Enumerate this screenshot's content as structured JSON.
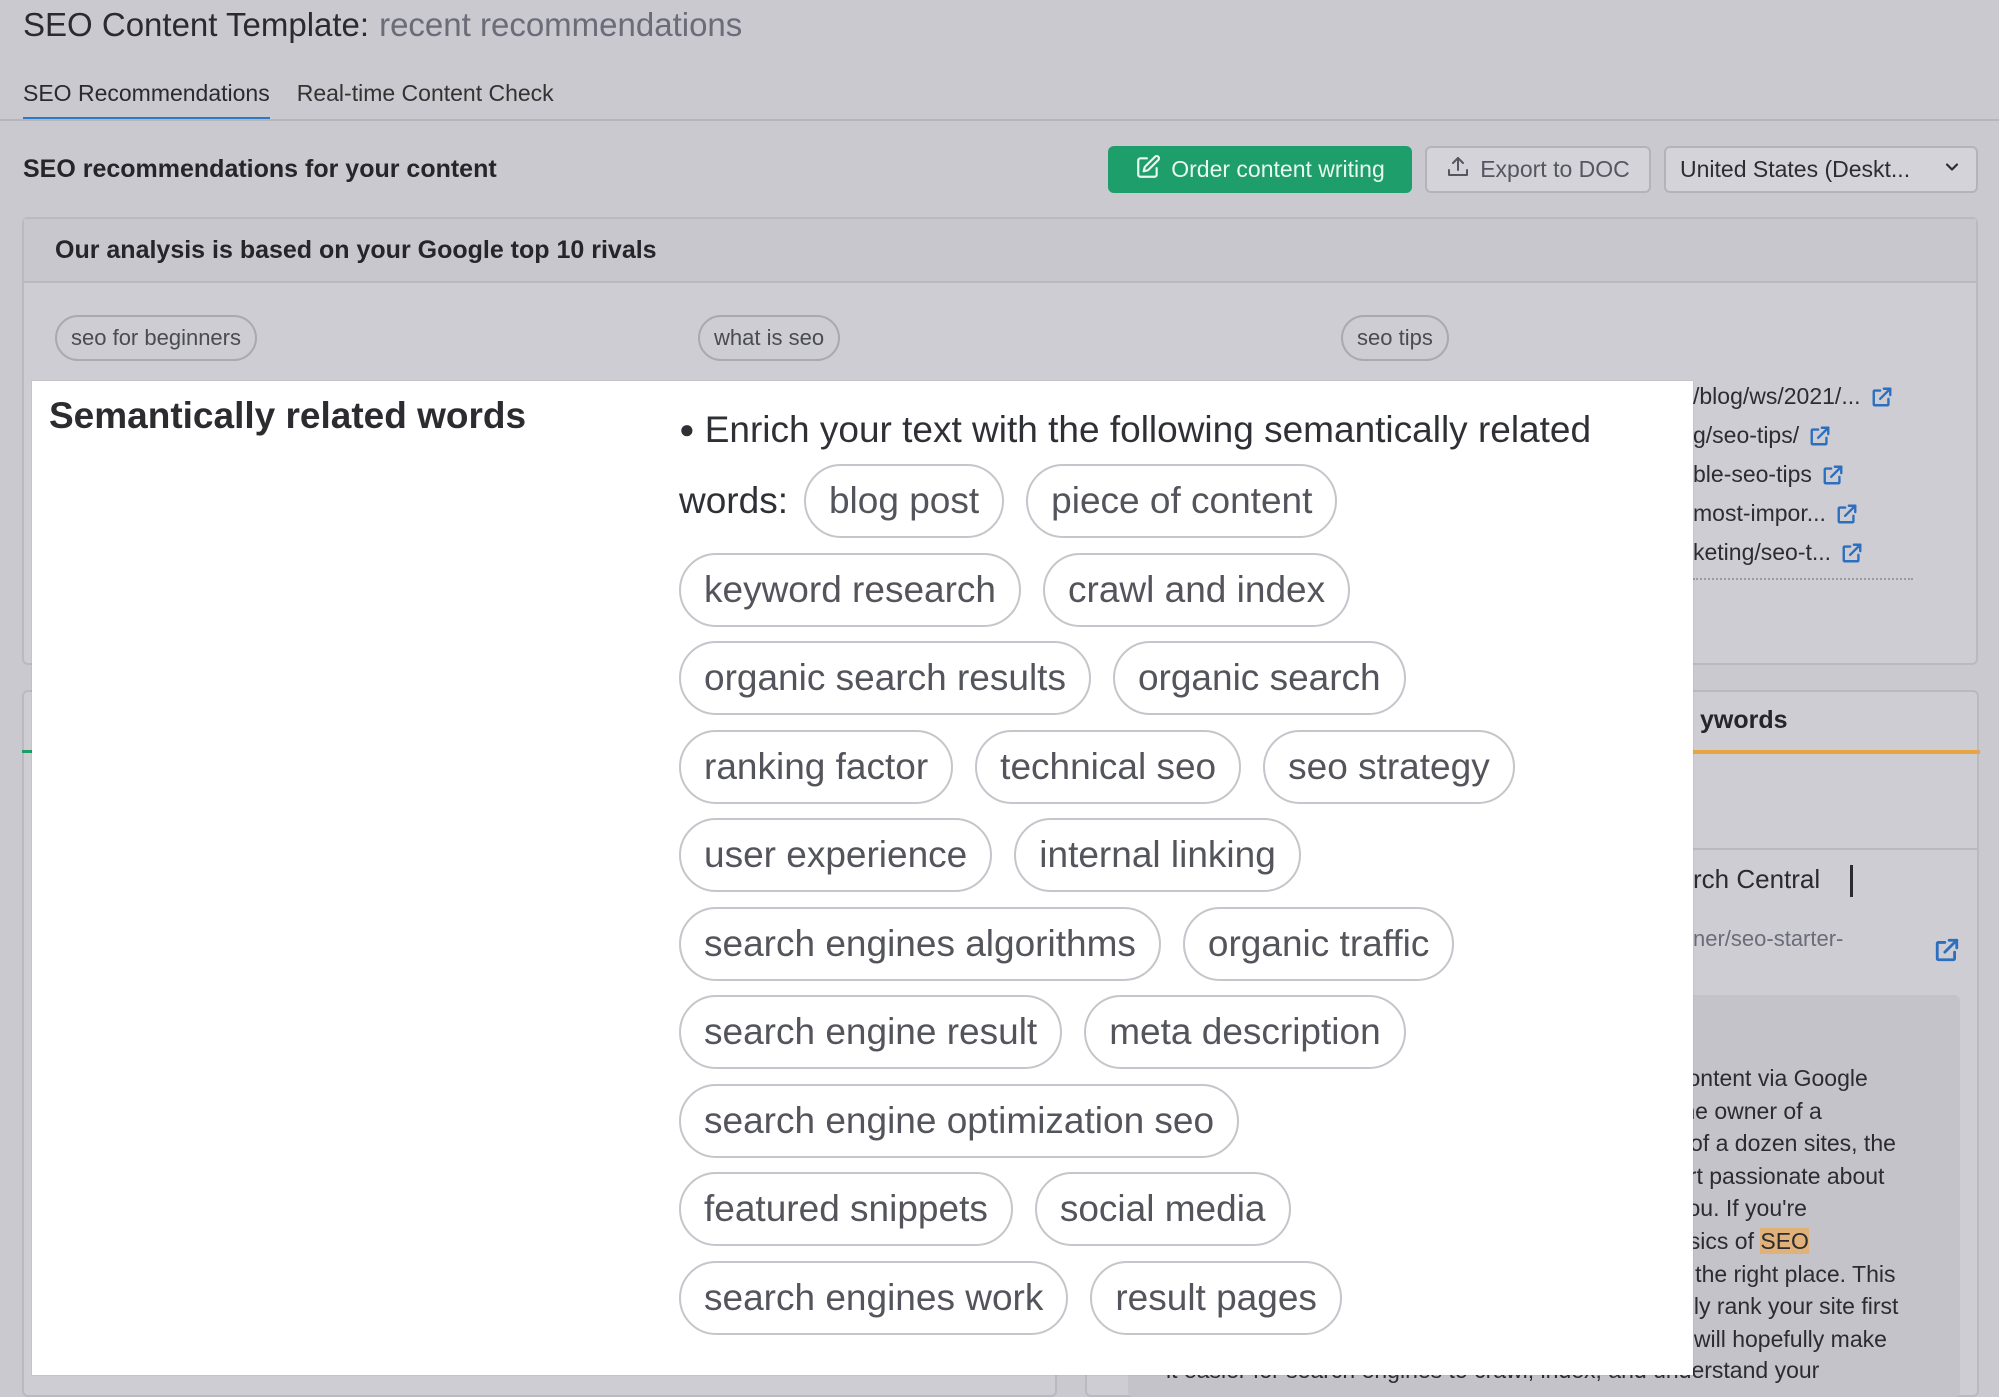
{
  "header": {
    "title": "SEO Content Template:",
    "subtitle": "recent recommendations"
  },
  "tabs": [
    {
      "label": "SEO Recommendations",
      "active": true
    },
    {
      "label": "Real-time Content Check",
      "active": false
    }
  ],
  "toolbar": {
    "section_title": "SEO recommendations for your content",
    "order_label": "Order content writing",
    "export_label": "Export to DOC",
    "region_value": "United States (Deskt..."
  },
  "analysis": {
    "title": "Our analysis is based on your Google top 10 rivals",
    "keywords": [
      "seo for beginners",
      "what is seo",
      "seo tips"
    ],
    "urls": [
      "/blog/ws/2021/...",
      "g/seo-tips/",
      "ble-seo-tips",
      "most-impor...",
      "keting/seo-t..."
    ]
  },
  "keywords_panel": {
    "title": "ywords",
    "source_title": "rch Central",
    "source_url": "ner/seo-starter-",
    "excerpt_lines": [
      "content via Google",
      "the owner of a",
      "r of a dozen sites, the",
      "ert passionate about",
      "you. If you're",
      "asics of ",
      "n the right place. This",
      "ally rank your site first",
      "s will hopefully make"
    ],
    "excerpt_highlight": "SEO",
    "excerpt_last_line": "it easier for search engines to crawl, index, and understand your"
  },
  "semantic": {
    "title": "Semantically related words",
    "intro": "Enrich your text with the following semantically related",
    "words_label": "words:",
    "rows": [
      [
        "blog post",
        "piece of content"
      ],
      [
        "keyword research",
        "crawl and index"
      ],
      [
        "organic search results",
        "organic search"
      ],
      [
        "ranking factor",
        "technical seo",
        "seo strategy"
      ],
      [
        "user experience",
        "internal linking"
      ],
      [
        "search engines algorithms",
        "organic traffic"
      ],
      [
        "search engine result",
        "meta description"
      ],
      [
        "search engine optimization seo"
      ],
      [
        "featured snippets",
        "social media"
      ],
      [
        "search engines work",
        "result pages"
      ]
    ]
  },
  "colors": {
    "accent_green": "#1e9e6a",
    "tab_active": "#2d78c8",
    "keywords_underline": "#e9a640",
    "link_blue": "#2d6fbf",
    "highlight": "#e0b27a"
  },
  "icons": [
    "edit-icon",
    "upload-icon",
    "chevron-down-icon",
    "external-link-icon"
  ]
}
